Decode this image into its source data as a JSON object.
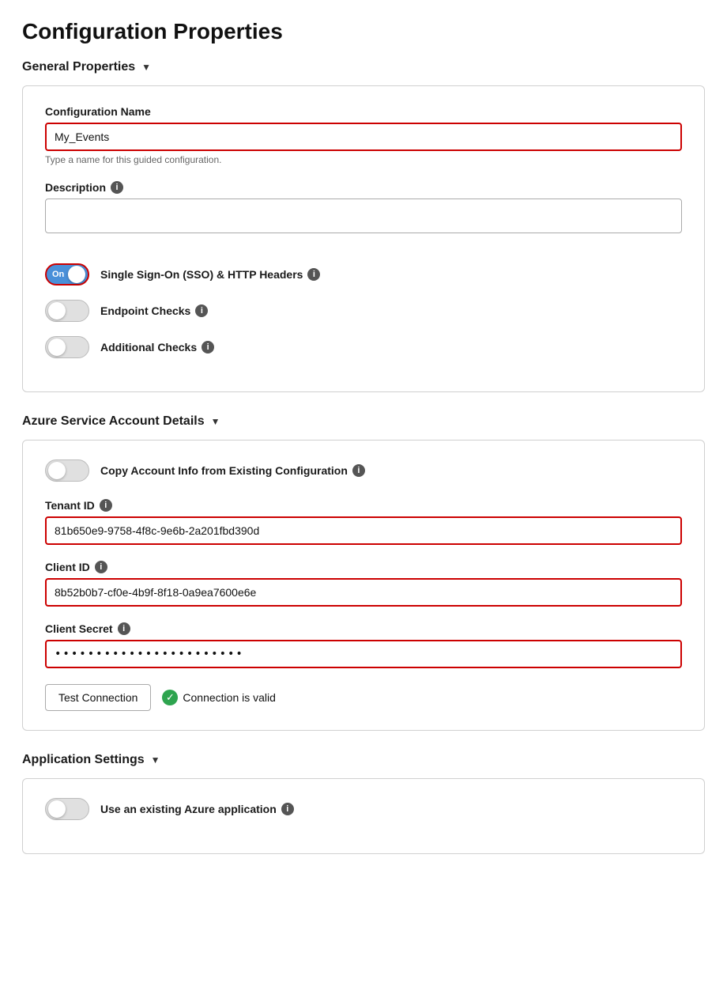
{
  "page": {
    "title": "Configuration Properties"
  },
  "general_properties": {
    "section_label": "General Properties",
    "config_name": {
      "label": "Configuration Name",
      "value": "My_Events",
      "hint": "Type a name for this guided configuration."
    },
    "description": {
      "label": "Description",
      "info": "i",
      "value": "",
      "placeholder": ""
    },
    "sso_toggle": {
      "label": "Single Sign-On (SSO) & HTTP Headers",
      "info": "i",
      "state": "on",
      "text": "On"
    },
    "endpoint_checks": {
      "label": "Endpoint Checks",
      "info": "i",
      "state": "off"
    },
    "additional_checks": {
      "label": "Additional Checks",
      "info": "i",
      "state": "off"
    }
  },
  "azure_service": {
    "section_label": "Azure Service Account Details",
    "copy_toggle": {
      "label": "Copy Account Info from Existing Configuration",
      "info": "i",
      "state": "off"
    },
    "tenant_id": {
      "label": "Tenant ID",
      "info": "i",
      "value": "81b650e9-9758-4f8c-9e6b-2a201fbd390d"
    },
    "client_id": {
      "label": "Client ID",
      "info": "i",
      "value": "8b52b0b7-cf0e-4b9f-8f18-0a9ea7600e6e"
    },
    "client_secret": {
      "label": "Client Secret",
      "info": "i",
      "value": "••••••••••••••••••••••••••••"
    },
    "test_btn_label": "Test Connection",
    "connection_status": "Connection is valid"
  },
  "application_settings": {
    "section_label": "Application Settings",
    "use_existing_toggle": {
      "label": "Use an existing Azure application",
      "info": "i",
      "state": "off"
    }
  },
  "icons": {
    "chevron": "▼",
    "info": "i",
    "check": "✓"
  }
}
